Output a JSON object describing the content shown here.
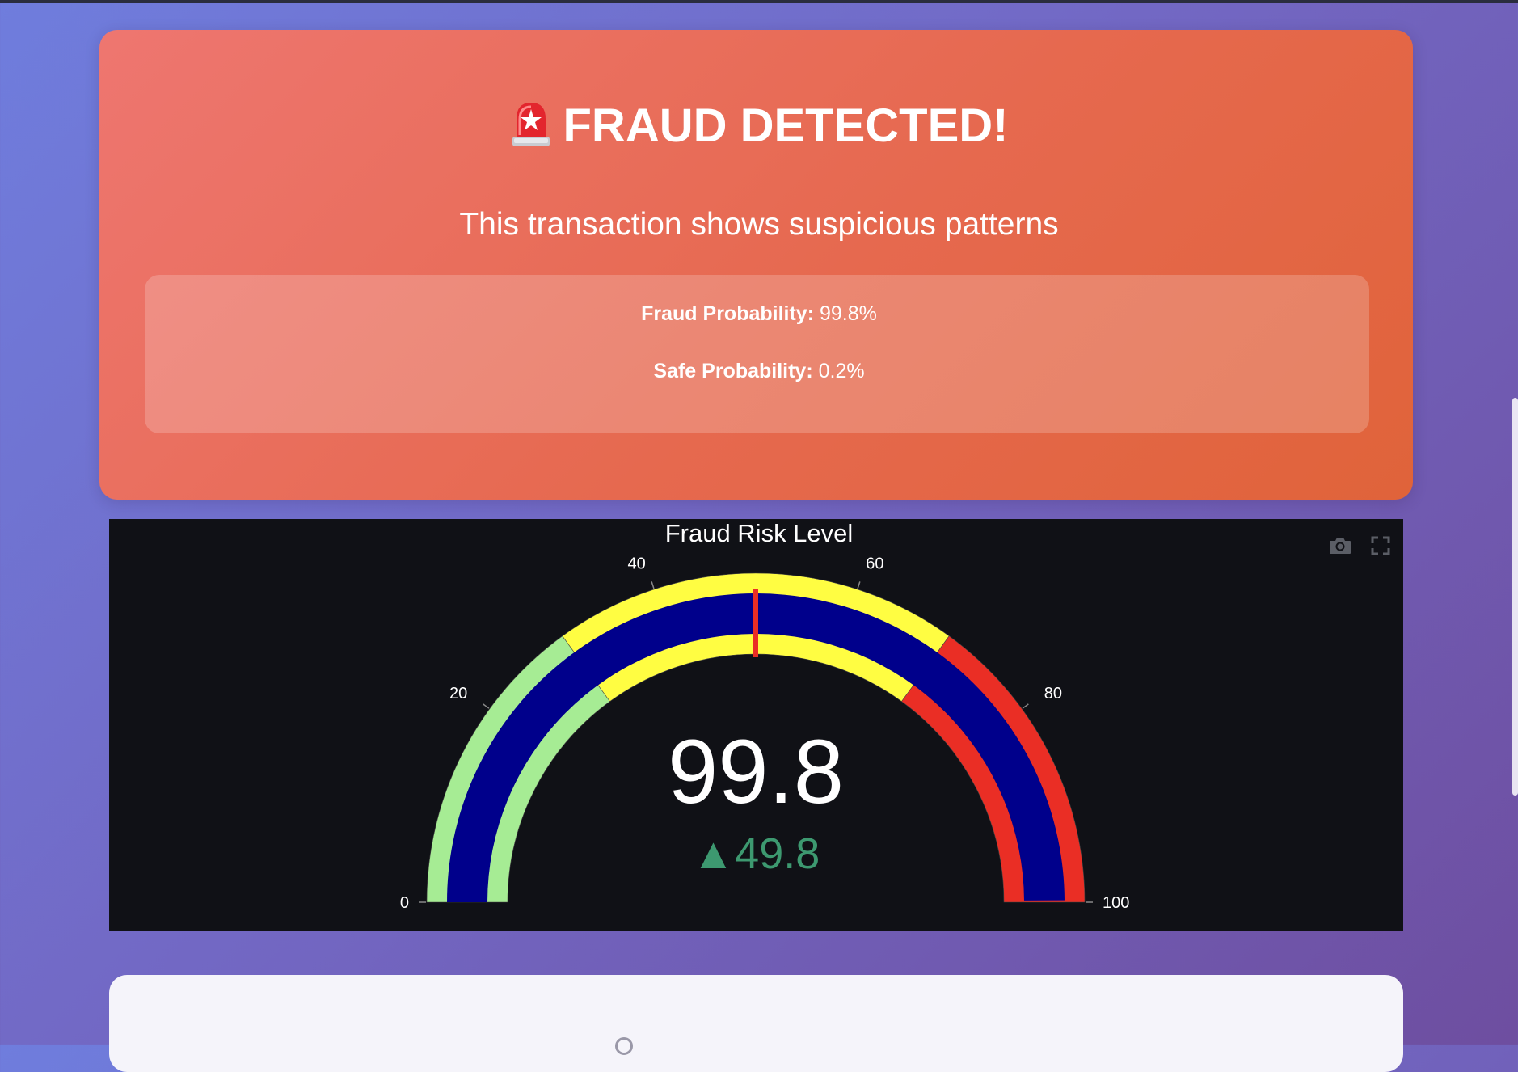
{
  "alert": {
    "icon": "siren-icon",
    "title": "FRAUD DETECTED!",
    "subtitle": "This transaction shows suspicious patterns",
    "fraud_label": "Fraud Probability:",
    "fraud_value": "99.8%",
    "safe_label": "Safe Probability:",
    "safe_value": "0.2%",
    "card_color": "#e9694f"
  },
  "gauge": {
    "title": "Fraud Risk Level",
    "value": 99.8,
    "value_text": "99.8",
    "delta_text": "▲49.8",
    "delta_color": "#3d9970",
    "range": [
      0,
      100
    ],
    "threshold": 50,
    "bar_color": "#00008b",
    "steps": [
      {
        "range": [
          0,
          30
        ],
        "color": "#a6ec94"
      },
      {
        "range": [
          30,
          70
        ],
        "color": "#fffd42"
      },
      {
        "range": [
          70,
          100
        ],
        "color": "#ea2e25"
      }
    ],
    "threshold_color": "#ea2e25",
    "ticks": [
      {
        "value": 0,
        "label": "0"
      },
      {
        "value": 20,
        "label": "20"
      },
      {
        "value": 40,
        "label": "40"
      },
      {
        "value": 60,
        "label": "60"
      },
      {
        "value": 80,
        "label": "80"
      },
      {
        "value": 100,
        "label": "100"
      }
    ],
    "toolbar": [
      "camera-icon",
      "fullscreen-icon"
    ]
  }
}
